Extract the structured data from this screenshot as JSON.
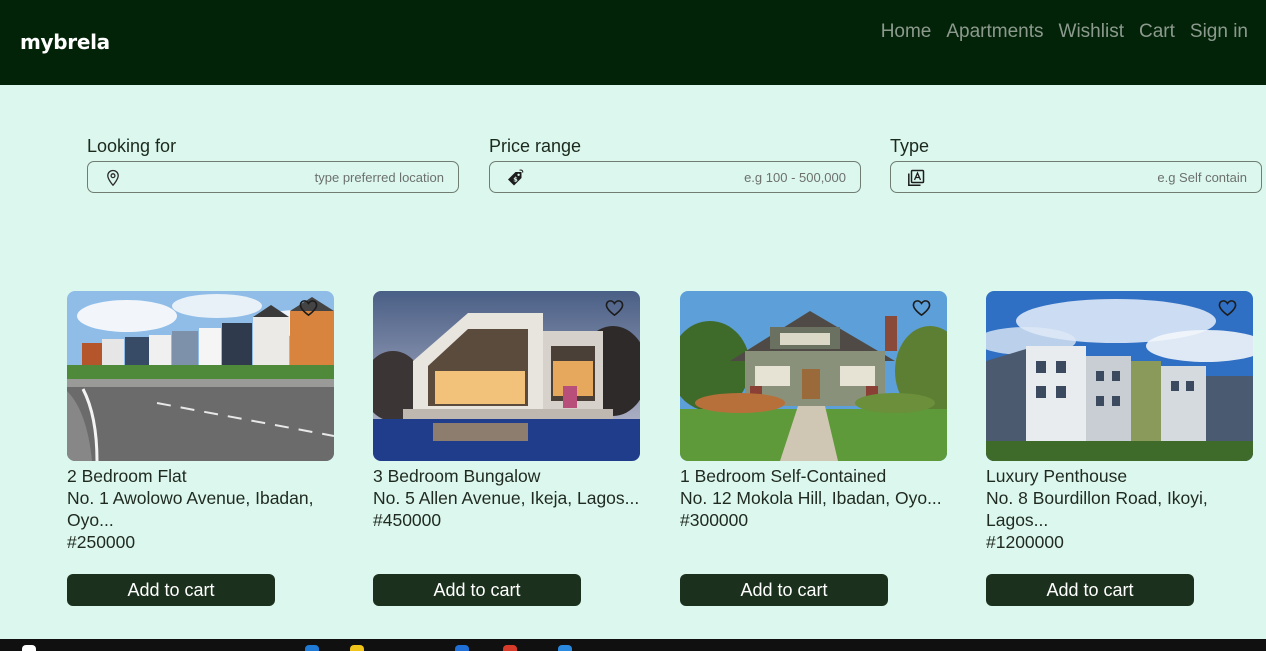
{
  "brand": "mybrela",
  "nav": {
    "links": [
      "Home",
      "Apartments",
      "Wishlist",
      "Cart",
      "Sign in"
    ]
  },
  "filters": {
    "location": {
      "label": "Looking for",
      "placeholder": "type preferred location",
      "icon": "location-pin-icon"
    },
    "price": {
      "label": "Price range",
      "placeholder": "e.g 100 - 500,000",
      "icon": "price-tag-icon"
    },
    "type": {
      "label": "Type",
      "placeholder": "e.g Self contain",
      "icon": "gallery-icon"
    }
  },
  "listings": [
    {
      "title": "2 Bedroom Flat",
      "address": "No. 1 Awolowo Avenue, Ibadan, Oyo...",
      "price": "#250000",
      "button": "Add to cart"
    },
    {
      "title": "3 Bedroom Bungalow",
      "address": "No. 5 Allen Avenue, Ikeja, Lagos...",
      "price": "#450000",
      "button": "Add to cart"
    },
    {
      "title": "1 Bedroom Self-Contained",
      "address": "No. 12 Mokola Hill, Ibadan, Oyo...",
      "price": "#300000",
      "button": "Add to cart"
    },
    {
      "title": "Luxury Penthouse",
      "address": "No. 8 Bourdillon Road, Ikoyi, Lagos...",
      "price": "#1200000",
      "button": "Add to cart"
    }
  ],
  "colors": {
    "navbar": "#022308",
    "page_bg": "#dcf7ee",
    "button": "#1c311d",
    "nav_link": "#8c9a8e"
  }
}
